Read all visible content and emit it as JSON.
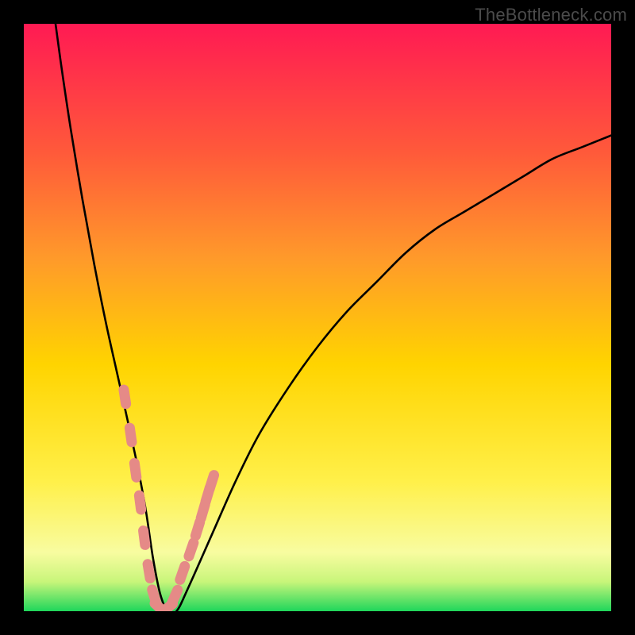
{
  "watermark": "TheBottleneck.com",
  "chart_data": {
    "type": "line",
    "title": "",
    "xlabel": "",
    "ylabel": "",
    "xlim": [
      0,
      100
    ],
    "ylim": [
      0,
      100
    ],
    "grid": false,
    "legend": false,
    "gradient_colors": {
      "top": "#ff1a53",
      "upper_mid": "#ff7a2a",
      "mid": "#ffd400",
      "lower_mid": "#fff04a",
      "band": "#f8fca0",
      "bottom": "#1fd65b"
    },
    "series": [
      {
        "name": "bottleneck-curve",
        "color": "#000000",
        "x": [
          5.4,
          6.5,
          8,
          10,
          12,
          14,
          16,
          18,
          19.5,
          20.8,
          22,
          23.2,
          24.5,
          26,
          28,
          32,
          36,
          40,
          45,
          50,
          55,
          60,
          65,
          70,
          75,
          80,
          85,
          90,
          95,
          100
        ],
        "y": [
          100,
          92,
          82,
          70,
          59,
          49,
          40,
          31,
          24,
          17,
          9,
          3,
          0,
          0,
          4,
          13,
          22,
          30,
          38,
          45,
          51,
          56,
          61,
          65,
          68,
          71,
          74,
          77,
          79,
          81
        ]
      },
      {
        "name": "marker-dots",
        "type": "scatter",
        "color": "#e58a87",
        "x": [
          17.2,
          18.2,
          19.0,
          19.8,
          20.5,
          21.3,
          22.2,
          23.2,
          24.4,
          25.7,
          27.0,
          28.5,
          29.6,
          30.5,
          31.3,
          32.0
        ],
        "y": [
          36.5,
          30.0,
          24.0,
          18.5,
          12.5,
          6.8,
          2.5,
          0.5,
          0.5,
          2.5,
          6.5,
          10.5,
          14.0,
          17.0,
          19.8,
          22.0
        ]
      }
    ]
  }
}
